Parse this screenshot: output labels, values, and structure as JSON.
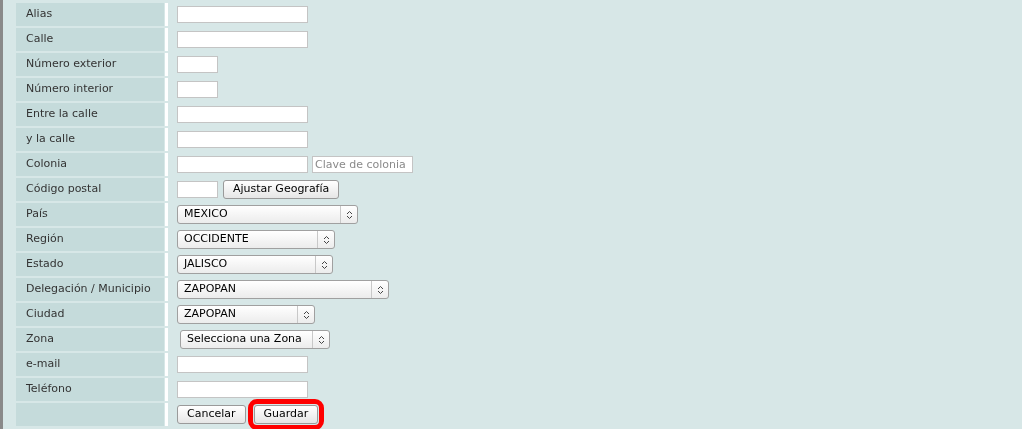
{
  "rows": [
    {
      "label": "Alias",
      "kind": "text"
    },
    {
      "label": "Calle",
      "kind": "text"
    },
    {
      "label": "Número exterior",
      "kind": "short"
    },
    {
      "label": "Número interior",
      "kind": "short"
    },
    {
      "label": "Entre la calle",
      "kind": "text"
    },
    {
      "label": "y la calle",
      "kind": "text"
    },
    {
      "label": "Colonia",
      "kind": "text-extra",
      "placeholder": "Clave de colonia"
    },
    {
      "label": "Código postal",
      "kind": "short-button",
      "button": "Ajustar Geografía"
    },
    {
      "label": "País",
      "kind": "select",
      "value": "MEXICO"
    },
    {
      "label": "Región",
      "kind": "select",
      "value": "OCCIDENTE"
    },
    {
      "label": "Estado",
      "kind": "select",
      "value": "JALISCO"
    },
    {
      "label": "Delegación / Municipio",
      "kind": "select",
      "value": "ZAPOPAN"
    },
    {
      "label": "Ciudad",
      "kind": "select",
      "value": "ZAPOPAN"
    },
    {
      "label": "Zona",
      "kind": "select",
      "value": "Selecciona una Zona"
    },
    {
      "label": "e-mail",
      "kind": "text"
    },
    {
      "label": "Teléfono",
      "kind": "text"
    },
    {
      "kind": "buttons",
      "buttons": [
        {
          "label": "Cancelar",
          "highlighted": false
        },
        {
          "label": "Guardar",
          "highlighted": true
        }
      ]
    }
  ]
}
